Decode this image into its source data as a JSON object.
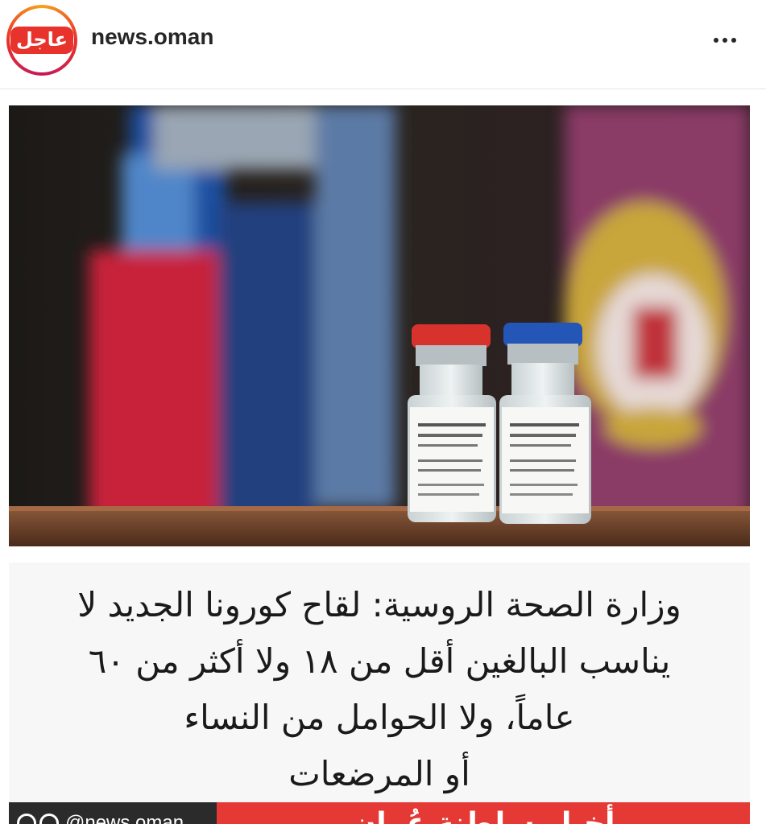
{
  "header": {
    "avatar_text": "عاجل",
    "username": "news.oman",
    "more_icon": "more-horizontal-icon"
  },
  "post": {
    "image_description_icon": "vaccine-vials-photo",
    "caption_lines": [
      "وزارة الصحة الروسية: لقاح كورونا الجديد لا",
      "يناسب البالغين أقل من ١٨ ولا أكثر من ٦٠",
      "عاماً، ولا الحوامل من النساء",
      "أو المرضعات"
    ],
    "footer": {
      "handle": "@news.oman",
      "banner_text": "أخبار سلطنة عُمان"
    }
  },
  "colors": {
    "accent_red": "#e8322c",
    "footer_dark": "#2b2b2b",
    "footer_red": "#e53935"
  }
}
